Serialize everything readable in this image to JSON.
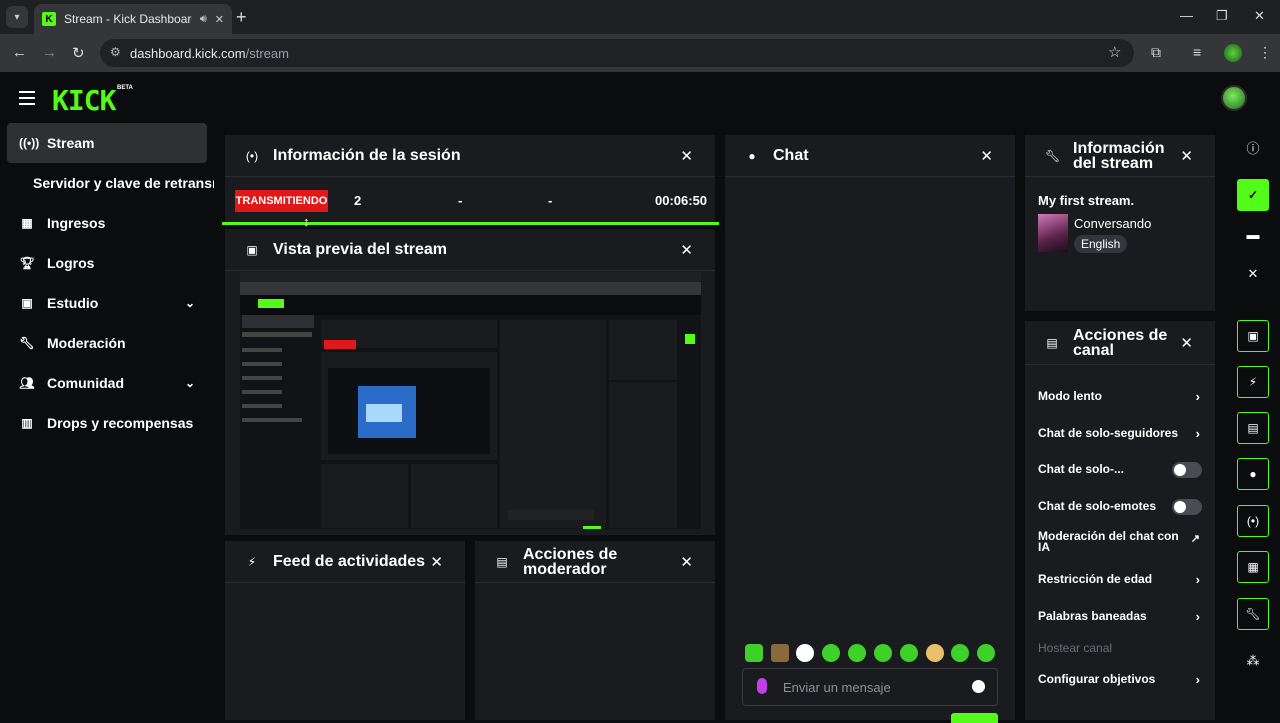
{
  "browser": {
    "tab_title": "Stream - Kick Dashboard",
    "url_host": "dashboard.kick.com",
    "url_path": "/stream"
  },
  "header": {
    "logo": "KICK",
    "badge": "BETA"
  },
  "sidebar": {
    "items": [
      {
        "label": "Stream",
        "icon": "broadcast-icon"
      },
      {
        "label": "Ingresos",
        "icon": "chart-icon"
      },
      {
        "label": "Logros",
        "icon": "trophy-icon"
      },
      {
        "label": "Estudio",
        "icon": "studio-icon"
      },
      {
        "label": "Moderación",
        "icon": "wrench-icon"
      },
      {
        "label": "Comunidad",
        "icon": "users-icon"
      },
      {
        "label": "Drops y recompensas",
        "icon": "gift-icon"
      }
    ],
    "sub_item": "Servidor y clave de retransmisión"
  },
  "session": {
    "title": "Información de la sesión",
    "status": "TRANSMITIENDO",
    "viewers": "2",
    "stat2": "-",
    "stat3": "-",
    "duration": "00:06:50"
  },
  "preview": {
    "title": "Vista previa del stream"
  },
  "activity": {
    "title": "Feed de actividades"
  },
  "mod_actions": {
    "title": "Acciones de moderador"
  },
  "chat": {
    "title": "Chat",
    "placeholder": "Enviar un mensaje"
  },
  "stream_info": {
    "title": "Información del stream",
    "stream_title": "My first stream.",
    "category": "Conversando",
    "language": "English"
  },
  "channel_actions": {
    "title": "Acciones de canal",
    "items": [
      {
        "label": "Modo lento",
        "control": "chevron"
      },
      {
        "label": "Chat de solo-seguidores",
        "control": "chevron"
      },
      {
        "label": "Chat de solo-...",
        "control": "toggle",
        "on": false
      },
      {
        "label": "Chat de solo-emotes",
        "control": "toggle",
        "on": false
      },
      {
        "label": "Moderación del chat con IA",
        "control": "external"
      },
      {
        "label": "Restricción de edad",
        "control": "chevron"
      },
      {
        "label": "Palabras baneadas",
        "control": "chevron"
      },
      {
        "label": "Hostear canal",
        "control": "none",
        "disabled": true
      },
      {
        "label": "Configurar objetivos",
        "control": "chevron"
      }
    ]
  },
  "colors": {
    "accent": "#53fc18",
    "live": "#e01818",
    "panel": "#191b1f",
    "background": "#0b0c0e"
  }
}
